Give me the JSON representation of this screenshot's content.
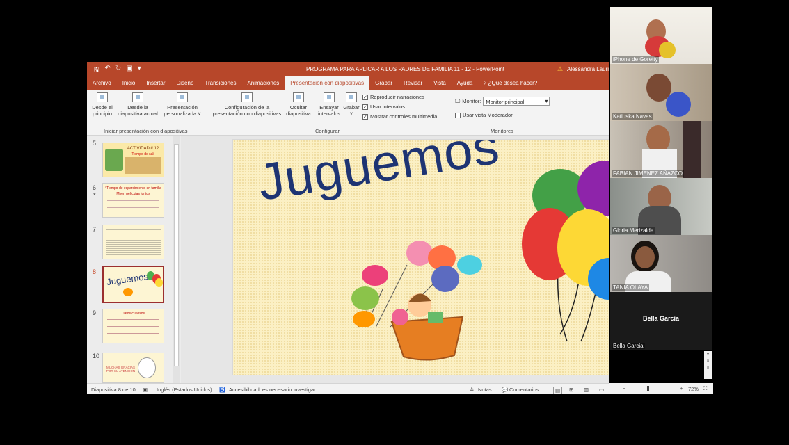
{
  "window": {
    "title": "PROGRAMA PARA APLICAR A LOS PADRES DE FAMILIA 11 - 12  -  PowerPoint",
    "user": "Alessandra Lauri",
    "qat_icons": [
      "save-icon",
      "undo-icon",
      "redo-icon",
      "from-beginning-icon",
      "customize-icon"
    ]
  },
  "tabs": [
    "Archivo",
    "Inicio",
    "Insertar",
    "Diseño",
    "Transiciones",
    "Animaciones",
    "Presentación con diapositivas",
    "Grabar",
    "Revisar",
    "Vista",
    "Ayuda"
  ],
  "active_tab": "Presentación con diapositivas",
  "tell_me": "¿Qué desea hacer?",
  "ribbon": {
    "start": {
      "from_beginning": [
        "Desde el",
        "principio"
      ],
      "from_current": [
        "Desde la",
        "diapositiva actual"
      ],
      "custom": [
        "Presentación",
        "personalizada ˅"
      ],
      "group_label": "Iniciar presentación con diapositivas"
    },
    "configure": {
      "setup": [
        "Configuración de la",
        "presentación con diapositivas"
      ],
      "hide": [
        "Ocultar",
        "diapositiva"
      ],
      "rehearse": [
        "Ensayar",
        "intervalos"
      ],
      "record": [
        "Grabar",
        "˅"
      ],
      "checkboxes": [
        {
          "label": "Reproducir narraciones",
          "checked": true
        },
        {
          "label": "Usar intervalos",
          "checked": true
        },
        {
          "label": "Mostrar controles multimedia",
          "checked": true
        }
      ],
      "group_label": "Configurar"
    },
    "monitors": {
      "monitor_label": "Monitor:",
      "monitor_value": "Monitor principal",
      "presenter_view": {
        "label": "Usar vista Moderador",
        "checked": false
      },
      "group_label": "Monitores"
    }
  },
  "thumbnails": [
    {
      "number": "5",
      "title": "ACTIVIDAD # 12",
      "subtitle": "Tiempo de sali",
      "selected": false
    },
    {
      "number": "6",
      "title": "*Tiempo de esparcimiento en familia",
      "subtitle": "Miren películas juntos",
      "selected": false,
      "starred": true
    },
    {
      "number": "7",
      "title": "",
      "subtitle": "",
      "selected": false
    },
    {
      "number": "8",
      "title": "Juguemos",
      "subtitle": "",
      "selected": true
    },
    {
      "number": "9",
      "title": "Datos curiosos",
      "subtitle": "",
      "selected": false
    },
    {
      "number": "10",
      "title": "MUCHAS GRACIAS POR SU ATENCION",
      "subtitle": "",
      "selected": false
    }
  ],
  "slide": {
    "title": "Juguemos",
    "colors": {
      "title": "#1e3473",
      "background": "#fbf0c4"
    }
  },
  "statusbar": {
    "slide_info": "Diapositiva 8 de 10",
    "language": "Inglés (Estados Unidos)",
    "accessibility": "Accesibilidad: es necesario investigar",
    "notes": "Notas",
    "comments": "Comentarios",
    "zoom": "72%",
    "zoom_minus": "−",
    "zoom_plus": "+"
  },
  "participants": [
    {
      "name": "iPhone de Goretty",
      "camera": true
    },
    {
      "name": "Katiuska Navas",
      "camera": true
    },
    {
      "name": "FABIAN JIMENEZ AÑAZCO",
      "camera": true
    },
    {
      "name": "Gloria Merizalde",
      "camera": true
    },
    {
      "name": "TANIA OLAYA",
      "camera": true
    },
    {
      "name": "Bella Garcia",
      "display_name": "Bella Garcia",
      "camera": false
    }
  ],
  "accent_color": "#b7472a"
}
